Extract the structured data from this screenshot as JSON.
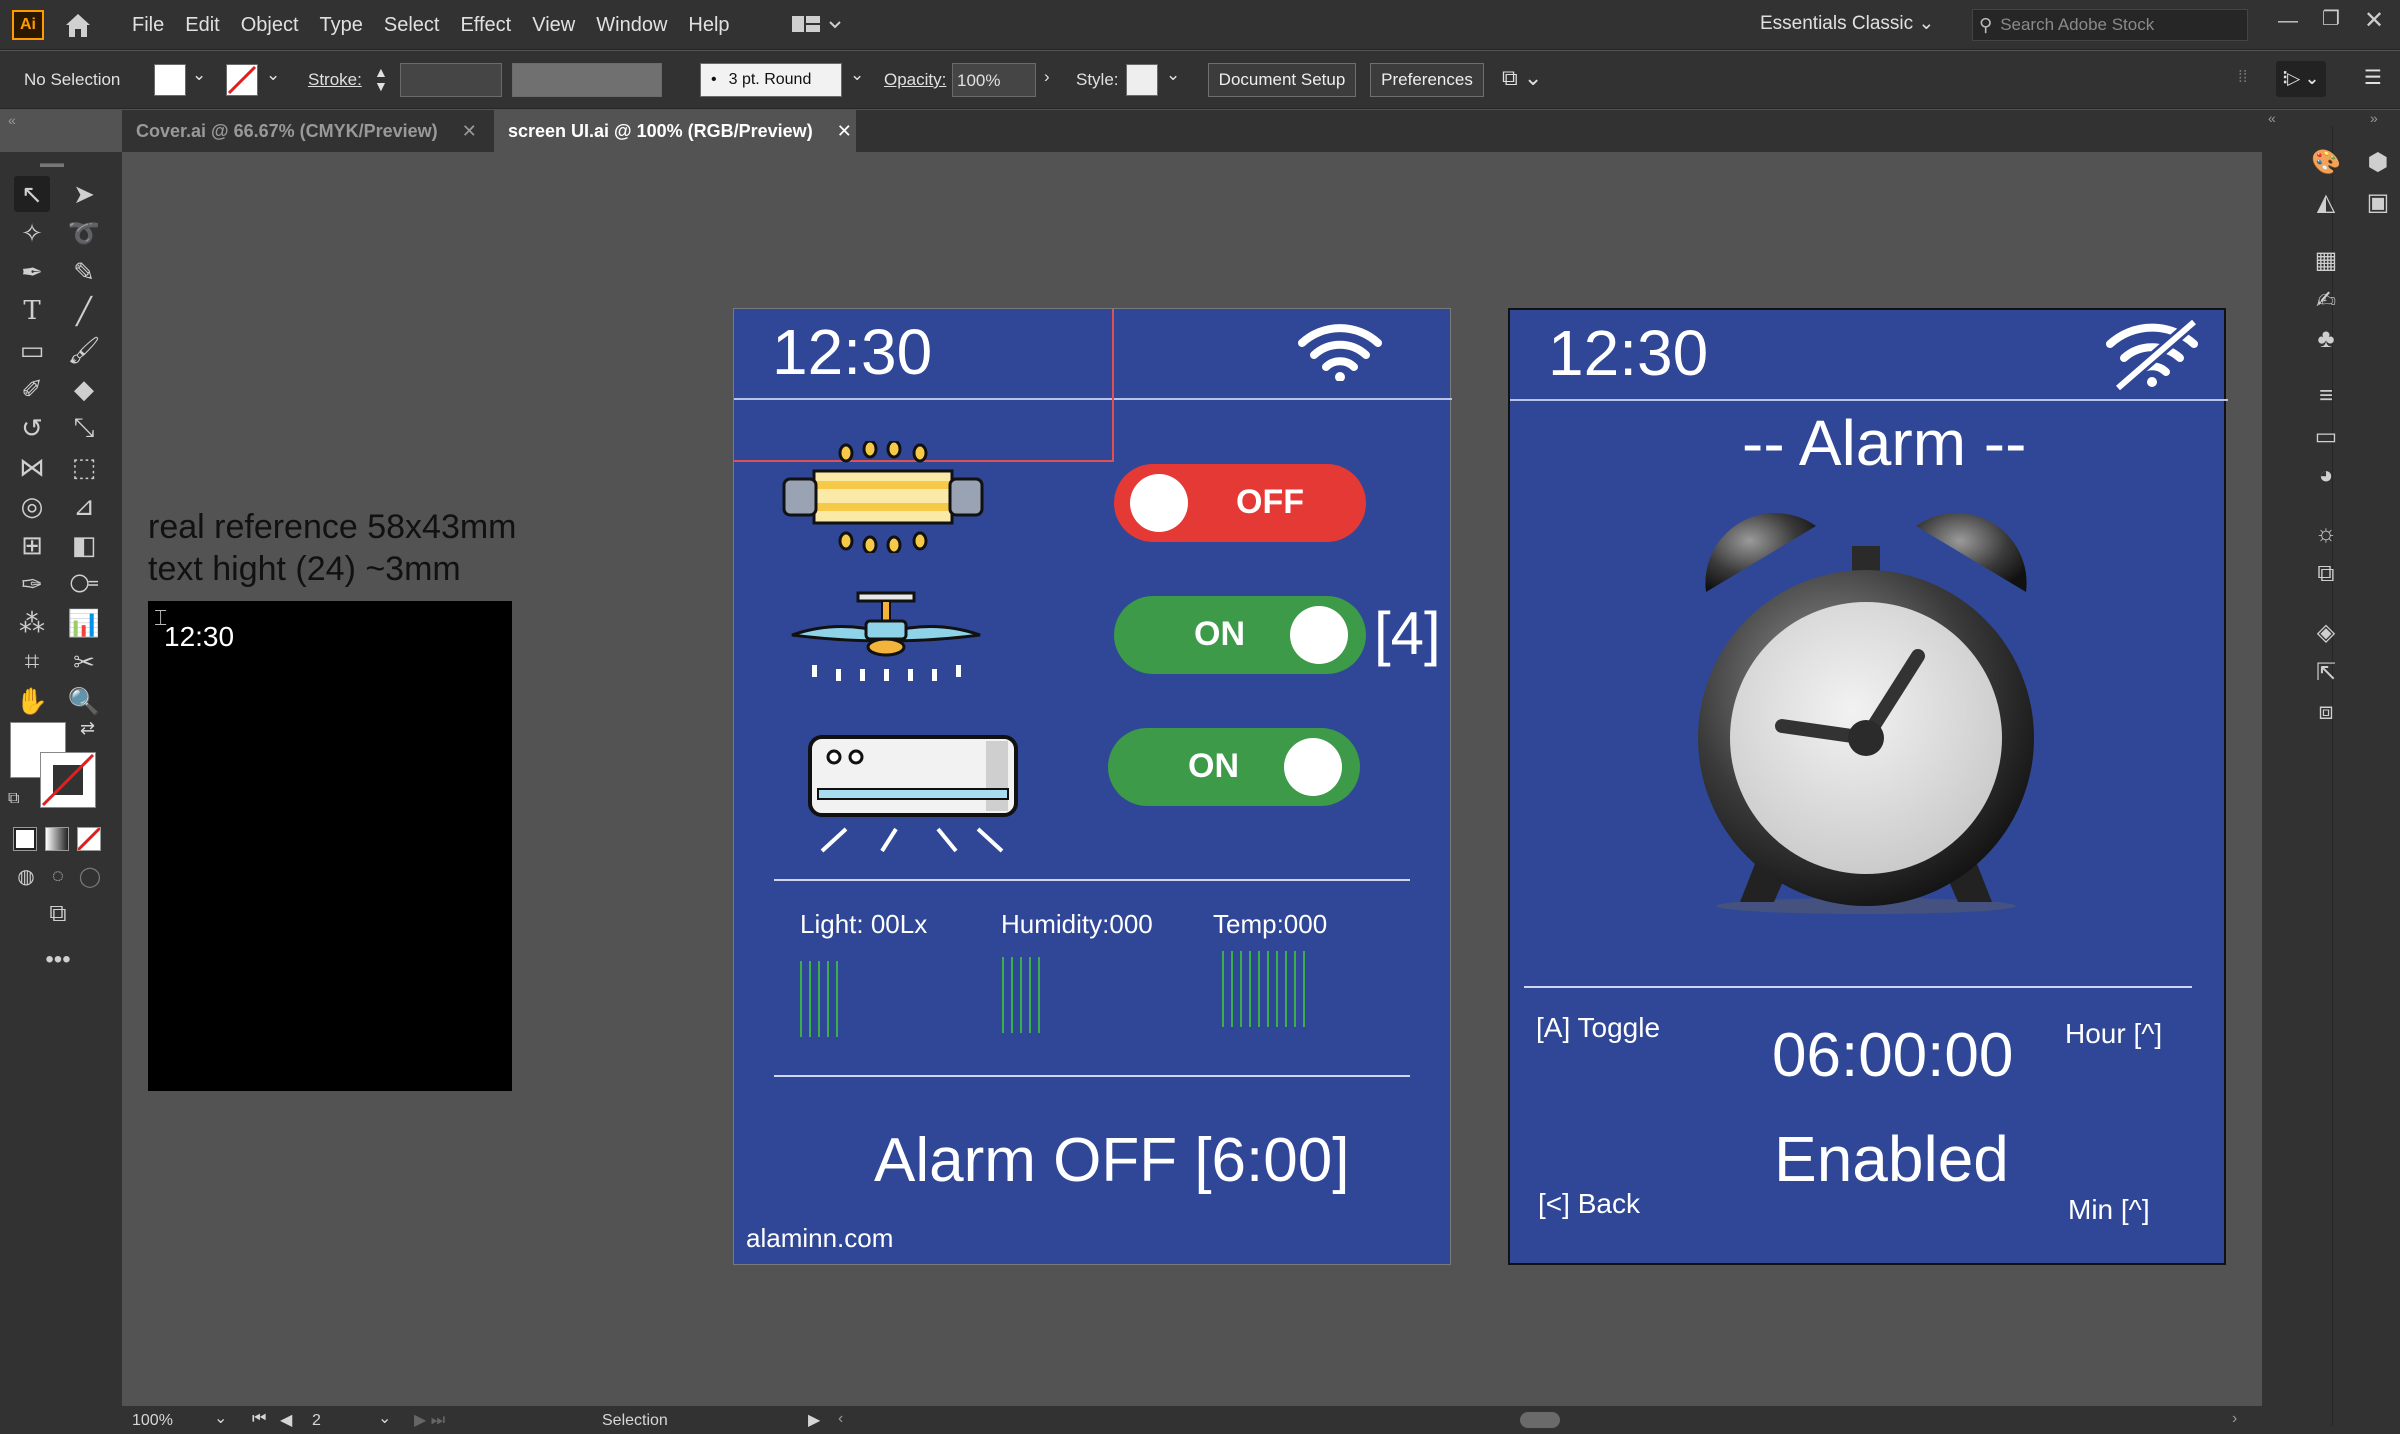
{
  "app": {
    "logo": "Ai",
    "menu": [
      "File",
      "Edit",
      "Object",
      "Type",
      "Select",
      "Effect",
      "View",
      "Window",
      "Help"
    ],
    "workspace": "Essentials Classic",
    "search_placeholder": "Search Adobe Stock"
  },
  "control": {
    "selection": "No Selection",
    "stroke_label": "Stroke:",
    "brush": "3 pt. Round",
    "opacity_label": "Opacity:",
    "opacity_value": "100%",
    "style_label": "Style:",
    "document_setup": "Document Setup",
    "preferences": "Preferences"
  },
  "tabs": [
    {
      "label": "Cover.ai @ 66.67% (CMYK/Preview)",
      "active": false
    },
    {
      "label": "screen UI.ai @ 100% (RGB/Preview)",
      "active": true
    }
  ],
  "status": {
    "zoom": "100%",
    "page": "2",
    "tool": "Selection"
  },
  "canvas": {
    "reference": {
      "line1": "real reference 58x43mm",
      "line2": "text hight (24) ~3mm",
      "preview_time": "12:30"
    },
    "board1": {
      "time": "12:30",
      "toggles": [
        {
          "label": "OFF",
          "state": "off",
          "color": "#e53935"
        },
        {
          "label": "ON",
          "state": "on",
          "color": "#3c9a48"
        },
        {
          "label": "ON",
          "state": "on",
          "color": "#3c9a48"
        }
      ],
      "annotation": "[4]",
      "sensors": [
        {
          "label": "Light: 00Lx"
        },
        {
          "label": "Humidity:000"
        },
        {
          "label": "Temp:000"
        }
      ],
      "alarm": "Alarm OFF [6:00]",
      "footer": "alaminn.com"
    },
    "board2": {
      "time": "12:30",
      "title": "-- Alarm --",
      "toggle_hint": "[A] Toggle",
      "clock": "06:00:00",
      "hour_hint": "Hour [^]",
      "status": "Enabled",
      "back_hint": "[<] Back",
      "min_hint": "Min [^]"
    }
  }
}
